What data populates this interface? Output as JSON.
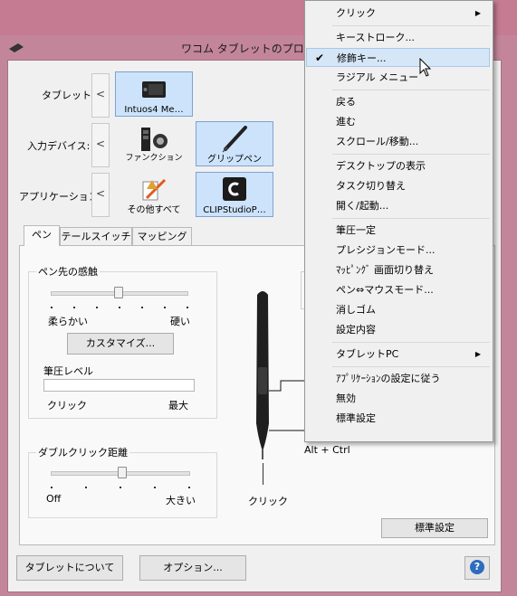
{
  "window": {
    "title": "ワコム タブレットのプロパティ"
  },
  "rows": {
    "tablet": {
      "label": "タブレット:",
      "items": [
        {
          "caption": "Intuos4 Me…",
          "selected": true,
          "icon": "tablet-icon"
        }
      ]
    },
    "device": {
      "label": "入力デバイス:",
      "items": [
        {
          "caption": "ファンクション",
          "selected": false,
          "icon": "function-icon"
        },
        {
          "caption": "グリップペン",
          "selected": true,
          "icon": "pen-icon"
        }
      ]
    },
    "app": {
      "label": "アプリケーション:",
      "items": [
        {
          "caption": "その他すべて",
          "selected": false,
          "icon": "all-apps-icon"
        },
        {
          "caption": "CLIPStudioP…",
          "selected": true,
          "icon": "clip-studio-icon"
        }
      ]
    },
    "left_arrow": "<"
  },
  "tabs": [
    "ペン",
    "テールスイッチ",
    "マッピング"
  ],
  "tip_feel": {
    "title": "ペン先の感触",
    "soft": "柔らかい",
    "firm": "硬い",
    "level": 0.5,
    "customize": "カスタマイズ...",
    "pressure_title": "筆圧レベル",
    "click": "クリック",
    "max": "最大"
  },
  "double_click": {
    "title": "ダブルクリック距離",
    "off": "Off",
    "large": "大きい",
    "level": 0.55
  },
  "pen": {
    "click_label": "クリック",
    "modifier_label": "Alt + Ctrl"
  },
  "buttons": {
    "default": "標準設定",
    "about": "タブレットについて",
    "options": "オプション...",
    "help": "?"
  },
  "menu": {
    "items": [
      {
        "label": "クリック",
        "submenu": true
      },
      {
        "sep": true
      },
      {
        "label": "キーストローク..."
      },
      {
        "label": "修飾キー...",
        "checked": true,
        "highlighted": true
      },
      {
        "label": "ラジアル メニュー"
      },
      {
        "sep": true
      },
      {
        "label": "戻る"
      },
      {
        "label": "進む"
      },
      {
        "label": "スクロール/移動..."
      },
      {
        "sep": true
      },
      {
        "label": "デスクトップの表示"
      },
      {
        "label": "タスク切り替え"
      },
      {
        "label": "開く/起動..."
      },
      {
        "sep": true
      },
      {
        "label": "筆圧一定"
      },
      {
        "label": "プレシジョンモード..."
      },
      {
        "label": "ﾏｯﾋﾟﾝｸﾞ 画面切り替え"
      },
      {
        "label": "ペン⇔マウスモード..."
      },
      {
        "label": "消しゴム"
      },
      {
        "label": "設定内容"
      },
      {
        "sep": true
      },
      {
        "label": "タブレットPC",
        "submenu": true
      },
      {
        "sep": true
      },
      {
        "label": "ｱﾌﾟﾘｹｰｼｮﾝの設定に従う"
      },
      {
        "label": "無効"
      },
      {
        "label": "標準設定"
      }
    ],
    "check_glyph": "✔",
    "arrow_glyph": "▶"
  },
  "colors": {
    "accent": "#cde3fb",
    "window": "#c3859a"
  }
}
